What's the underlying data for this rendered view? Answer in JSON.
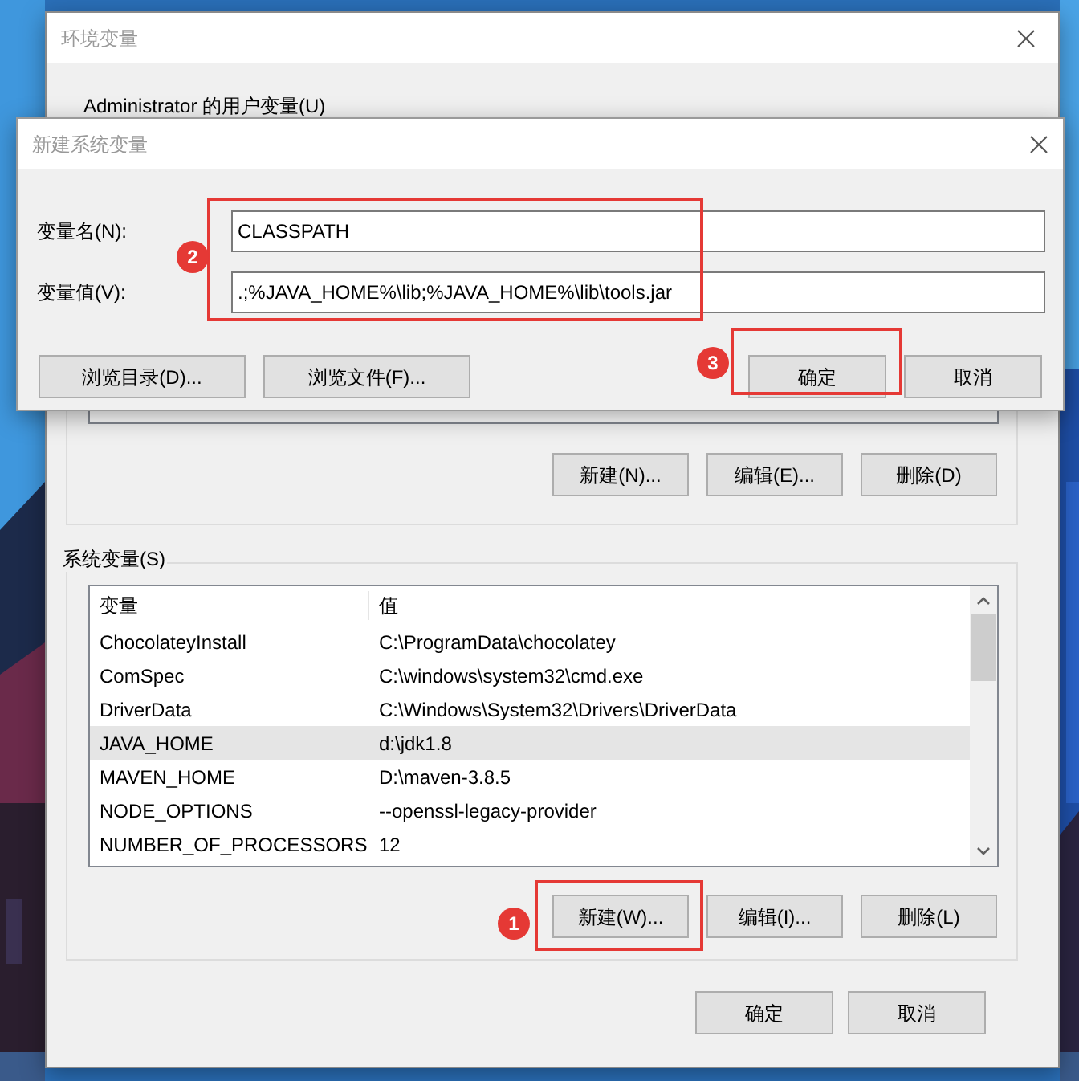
{
  "background_window": {
    "title": "环境变量",
    "user_variables_label": "Administrator 的用户变量(U)",
    "user_buttons": [
      {
        "label": "新建(N)..."
      },
      {
        "label": "编辑(E)..."
      },
      {
        "label": "删除(D)"
      }
    ],
    "system_variables_label": "系统变量(S)",
    "system_table": {
      "columns": [
        "变量",
        "值"
      ],
      "rows": [
        {
          "name": "ChocolateyInstall",
          "value": "C:\\ProgramData\\chocolatey",
          "selected": false
        },
        {
          "name": "ComSpec",
          "value": "C:\\windows\\system32\\cmd.exe",
          "selected": false
        },
        {
          "name": "DriverData",
          "value": "C:\\Windows\\System32\\Drivers\\DriverData",
          "selected": false
        },
        {
          "name": "JAVA_HOME",
          "value": "d:\\jdk1.8",
          "selected": true
        },
        {
          "name": "MAVEN_HOME",
          "value": "D:\\maven-3.8.5",
          "selected": false
        },
        {
          "name": "NODE_OPTIONS",
          "value": "--openssl-legacy-provider",
          "selected": false
        },
        {
          "name": "NUMBER_OF_PROCESSORS",
          "value": "12",
          "selected": false
        }
      ]
    },
    "system_buttons": [
      {
        "label": "新建(W)...",
        "callout": "1"
      },
      {
        "label": "编辑(I)..."
      },
      {
        "label": "删除(L)"
      }
    ],
    "footer_buttons": [
      {
        "label": "确定"
      },
      {
        "label": "取消"
      }
    ]
  },
  "dialog": {
    "title": "新建系统变量",
    "fields_callout": "2",
    "fields": [
      {
        "label": "变量名(N):",
        "value": "CLASSPATH"
      },
      {
        "label": "变量值(V):",
        "value": ".;%JAVA_HOME%\\lib;%JAVA_HOME%\\lib\\tools.jar"
      }
    ],
    "browse_buttons": [
      {
        "label": "浏览目录(D)..."
      },
      {
        "label": "浏览文件(F)..."
      }
    ],
    "buttons": [
      {
        "label": "确定",
        "callout": "3"
      },
      {
        "label": "取消"
      }
    ]
  }
}
